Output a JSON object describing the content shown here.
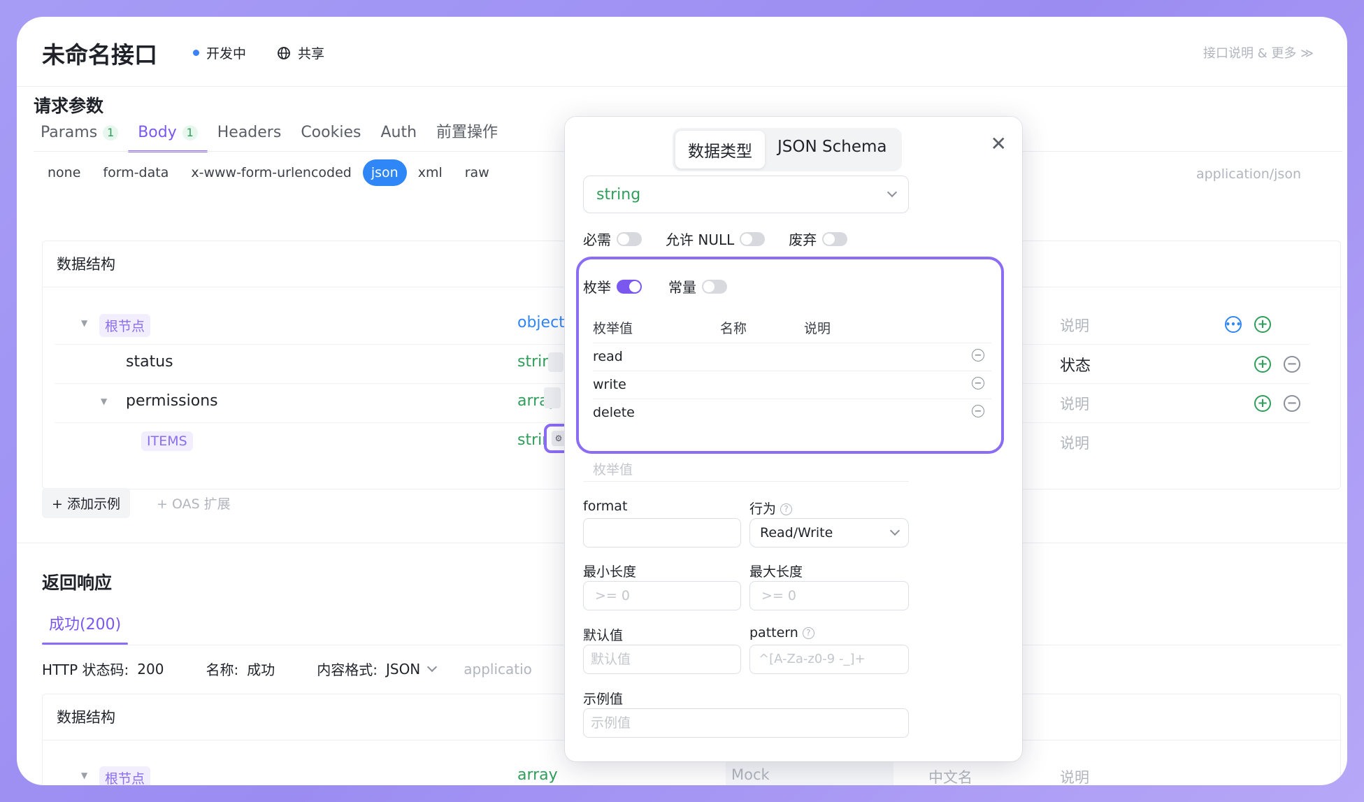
{
  "header": {
    "title": "未命名接口",
    "status": "开发中",
    "share": "共享",
    "more": "接口说明 & 更多 ≫"
  },
  "request": {
    "title": "请求参数",
    "tabs": [
      {
        "label": "Params",
        "count": "1"
      },
      {
        "label": "Body",
        "count": "1"
      },
      {
        "label": "Headers"
      },
      {
        "label": "Cookies"
      },
      {
        "label": "Auth"
      },
      {
        "label": "前置操作"
      }
    ],
    "body_types": [
      "none",
      "form-data",
      "x-www-form-urlencoded",
      "json",
      "xml",
      "raw"
    ],
    "content_type": "application/json",
    "structure_title": "数据结构",
    "rows": [
      {
        "name": "根节点",
        "type": "object",
        "desc": "说明"
      },
      {
        "name": "status",
        "type": "string",
        "desc": "状态"
      },
      {
        "name": "permissions",
        "type": "array",
        "required": "*",
        "desc": "说明"
      },
      {
        "name": "ITEMS",
        "type": "string",
        "desc": "说明"
      }
    ],
    "add_example": "+ 添加示例",
    "oas": "+ OAS 扩展"
  },
  "response": {
    "title": "返回响应",
    "tab": "成功(200)",
    "http_label": "HTTP 状态码:",
    "http_value": "200",
    "name_label": "名称:",
    "name_value": "成功",
    "format_label": "内容格式:",
    "format_value": "JSON",
    "content_type": "applicatio",
    "structure_title": "数据结构",
    "root": {
      "name": "根节点",
      "type": "array",
      "mock": "Mock",
      "cn": "中文名",
      "desc": "说明"
    }
  },
  "popover": {
    "seg": [
      "数据类型",
      "JSON Schema"
    ],
    "close": "✕",
    "type": "string",
    "flags": [
      "必需",
      "允许 NULL",
      "废弃"
    ],
    "enum_label": "枚举",
    "const_label": "常量",
    "enum_cols": [
      "枚举值",
      "名称",
      "说明"
    ],
    "enum_values": [
      "read",
      "write",
      "delete"
    ],
    "enum_placeholder": "枚举值",
    "format_label": "format",
    "behavior_label": "行为",
    "behavior_value": "Read/Write",
    "minlen_label": "最小长度",
    "maxlen_label": "最大长度",
    "minlen_ph": ">= 0",
    "maxlen_ph": ">= 0",
    "default_label": "默认值",
    "default_ph": "默认值",
    "pattern_label": "pattern",
    "pattern_ph": "^[A-Za-z0-9 -_]+",
    "example_label": "示例值",
    "example_ph": "示例值"
  }
}
